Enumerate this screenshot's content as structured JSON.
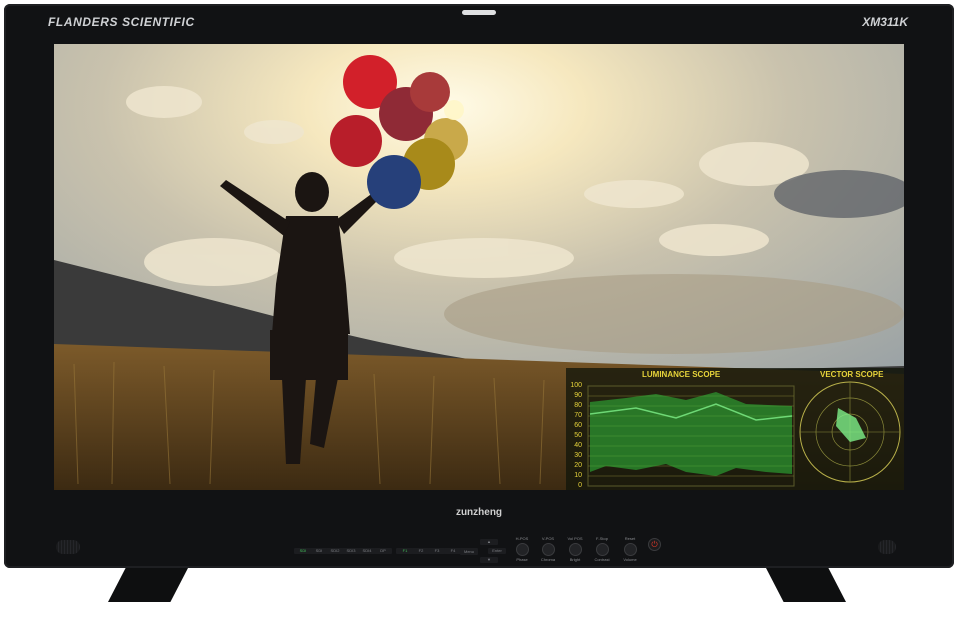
{
  "monitor": {
    "brand": "FLANDERS SCIENTIFIC",
    "model": "XM311K",
    "front_logo": "zunzheng"
  },
  "scopes": {
    "luminance_title": "LUMINANCE SCOPE",
    "vector_title": "VECTOR SCOPE",
    "scale": [
      "100",
      "90",
      "80",
      "70",
      "60",
      "50",
      "40",
      "30",
      "20",
      "10",
      "0"
    ]
  },
  "controls": {
    "left_buttons": [
      "SDI",
      "SDI2",
      "SDI3",
      "SDI4",
      "DP"
    ],
    "function_keys": [
      "F1",
      "F2",
      "F3",
      "F4",
      "F5"
    ],
    "nav": {
      "up": "▲",
      "down": "▼",
      "menu": "Menu",
      "enter": "Enter"
    },
    "knobs": [
      {
        "top": "H-POS",
        "bottom": "Phase"
      },
      {
        "top": "V-POS",
        "bottom": "Chroma"
      },
      {
        "top": "Vol POS",
        "bottom": "Bright"
      },
      {
        "top": "F-Stop",
        "bottom": "Contrast"
      },
      {
        "top": "Reset",
        "bottom": "Volume"
      }
    ],
    "power_icon": "power-icon"
  },
  "colors": {
    "bezel": "#111214",
    "scope_text": "#e6d33a",
    "scope_trace": "#3cd24a",
    "power": "#e03a2a"
  }
}
